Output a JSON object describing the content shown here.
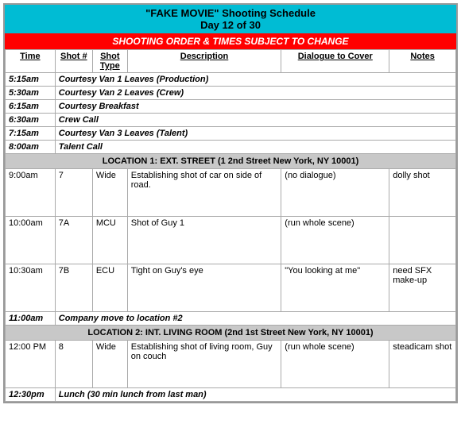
{
  "title": {
    "line1": "\"FAKE MOVIE\" Shooting Schedule",
    "line2": "Day 12 of 30"
  },
  "warning": "SHOOTING ORDER & TIMES SUBJECT TO CHANGE",
  "headers": {
    "time": "Time",
    "shot": "Shot #",
    "type": "Shot\nType",
    "description": "Description",
    "dialogue": "Dialogue to Cover",
    "notes": "Notes"
  },
  "rows": [
    {
      "type": "call",
      "time": "5:15am",
      "text": "Courtesy Van 1 Leaves (Production)"
    },
    {
      "type": "call",
      "time": "5:30am",
      "text": "Courtesy Van 2 Leaves (Crew)"
    },
    {
      "type": "call",
      "time": "6:15am",
      "text": "Courtesy Breakfast"
    },
    {
      "type": "call",
      "time": "6:30am",
      "text": "Crew Call"
    },
    {
      "type": "call",
      "time": "7:15am",
      "text": "Courtesy Van 3 Leaves (Talent)"
    },
    {
      "type": "call",
      "time": "8:00am",
      "text": "Talent Call"
    },
    {
      "type": "location",
      "text": "LOCATION 1: EXT. STREET (1 2nd Street New York, NY 10001)"
    },
    {
      "type": "scene",
      "time": "9:00am",
      "shot": "7",
      "shottype": "Wide",
      "desc": "Establishing shot of car on side of road.",
      "dialogue": "(no dialogue)",
      "notes": "dolly shot",
      "tall": true
    },
    {
      "type": "scene",
      "time": "10:00am",
      "shot": "7A",
      "shottype": "MCU",
      "desc": "Shot of Guy 1",
      "dialogue": "(run whole scene)",
      "notes": "",
      "tall": true
    },
    {
      "type": "scene",
      "time": "10:30am",
      "shot": "7B",
      "shottype": "ECU",
      "desc": "Tight on Guy's eye",
      "dialogue": "\"You looking at me\"",
      "notes": "need SFX make-up",
      "tall": true
    },
    {
      "type": "call",
      "time": "11:00am",
      "text": "Company move to location #2"
    },
    {
      "type": "location",
      "text": "LOCATION 2: INT. LIVING ROOM (2nd 1st Street New York, NY 10001)"
    },
    {
      "type": "scene",
      "time": "12:00 PM",
      "shot": "8",
      "shottype": "Wide",
      "desc": "Establishing shot of living room, Guy on couch",
      "dialogue": "(run whole scene)",
      "notes": "steadicam shot",
      "tall": true
    },
    {
      "type": "lunch",
      "time": "12:30pm",
      "text": "Lunch (30 min lunch from last man)"
    }
  ]
}
